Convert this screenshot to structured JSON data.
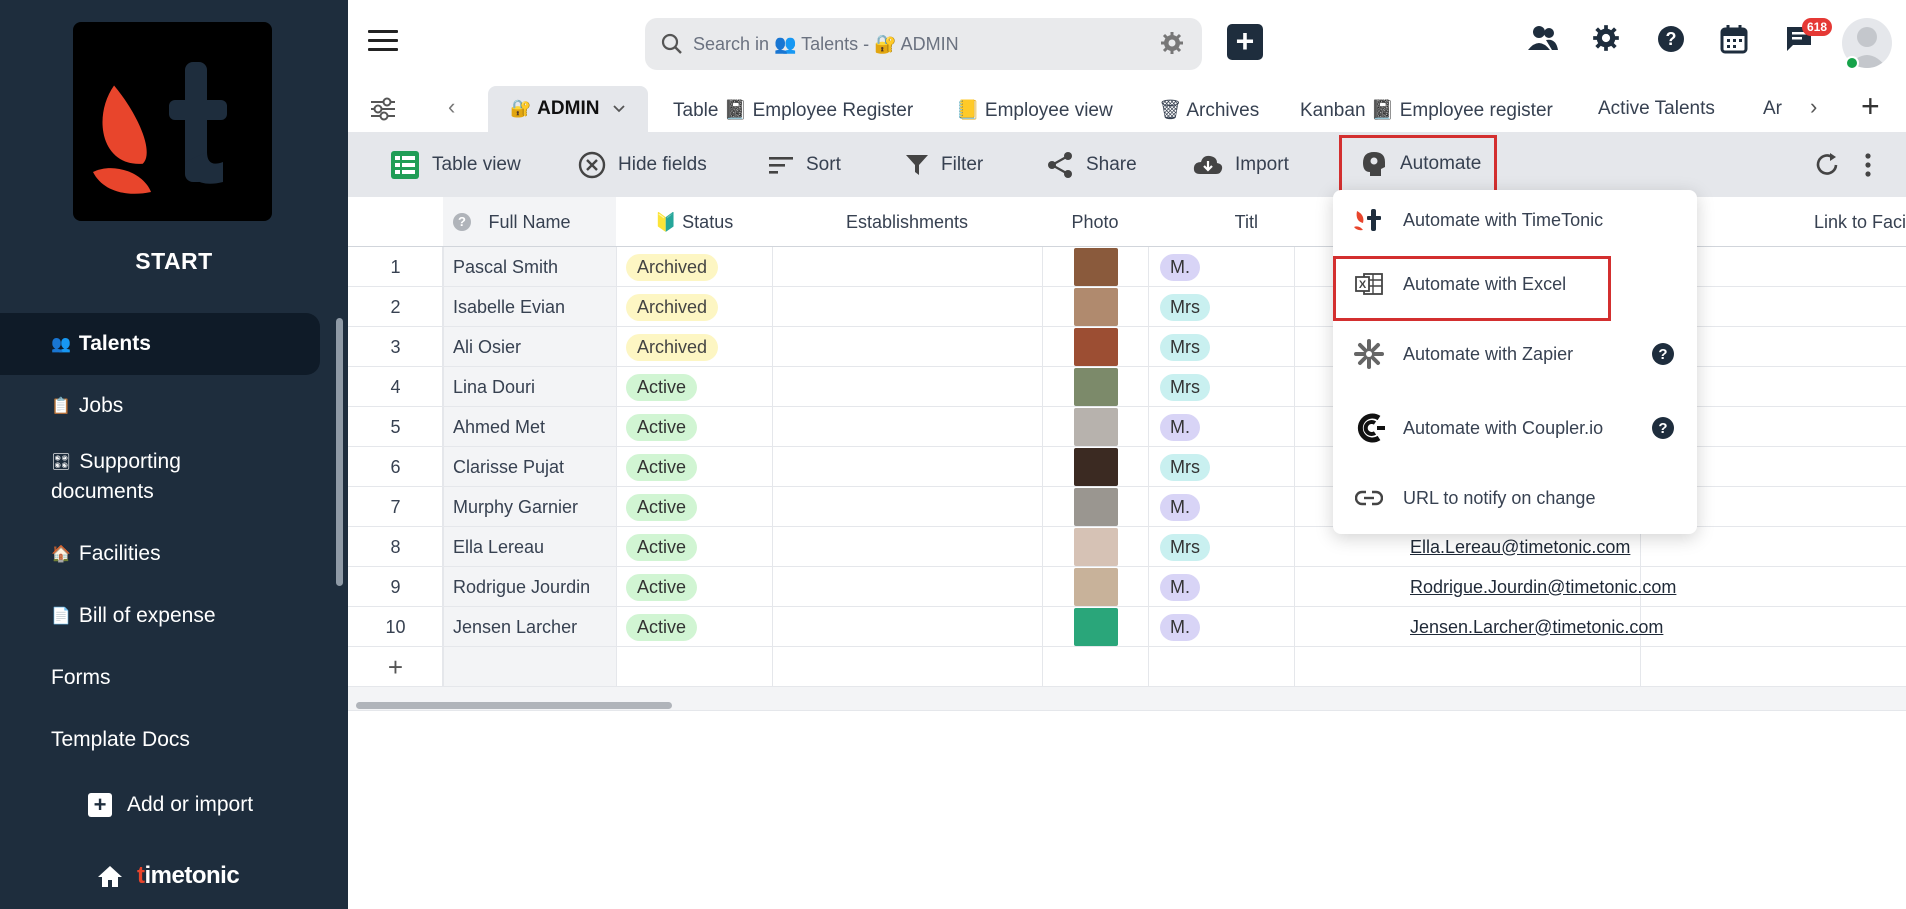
{
  "sidebar": {
    "app_name": "START",
    "items": [
      {
        "label": "Talents",
        "emoji": "👥"
      },
      {
        "label": "Jobs",
        "emoji": "📋"
      },
      {
        "label": "Supporting",
        "label2": "documents",
        "emoji": "🎛"
      },
      {
        "label": "Facilities",
        "emoji": "🏠"
      },
      {
        "label": "Bill of expense",
        "emoji": "📄"
      },
      {
        "label": "Forms"
      },
      {
        "label": "Template Docs"
      }
    ],
    "add_import": "Add or import",
    "brand": {
      "accent": "t",
      "rest": "imetonic"
    }
  },
  "topbar": {
    "search_placeholder": "Search in 👥 Talents - 🔐 ADMIN",
    "notification_count": "618"
  },
  "tabs": {
    "active": "ADMIN",
    "items": [
      "Table 📓 Employee Register",
      "📒 Employee view",
      "🗑 Archives",
      "Kanban 📓 Employee register",
      "Active Talents",
      "Ar"
    ]
  },
  "toolbar": {
    "table_view": "Table view",
    "hide_fields": "Hide fields",
    "sort": "Sort",
    "filter": "Filter",
    "share": "Share",
    "import": "Import",
    "automate": "Automate"
  },
  "table": {
    "columns": [
      "Full Name",
      "🔰 Status",
      "Establishments",
      "Photo",
      "Titl",
      "Link to Faci"
    ],
    "rows": [
      {
        "num": "1",
        "name": "Pascal Smith",
        "status": "Archived",
        "title": "M.",
        "email": ""
      },
      {
        "num": "2",
        "name": "Isabelle Evian",
        "status": "Archived",
        "title": "Mrs",
        "email": ""
      },
      {
        "num": "3",
        "name": "Ali Osier",
        "status": "Archived",
        "title": "Mrs",
        "email": ""
      },
      {
        "num": "4",
        "name": "Lina Douri",
        "status": "Active",
        "title": "Mrs",
        "email": ""
      },
      {
        "num": "5",
        "name": "Ahmed Met",
        "status": "Active",
        "title": "M.",
        "email": ""
      },
      {
        "num": "6",
        "name": "Clarisse Pujat",
        "status": "Active",
        "title": "Mrs",
        "email": ""
      },
      {
        "num": "7",
        "name": "Murphy Garnier",
        "status": "Active",
        "title": "M.",
        "email": ""
      },
      {
        "num": "8",
        "name": "Ella Lereau",
        "status": "Active",
        "title": "Mrs",
        "email": "Ella.Lereau@timetonic.com"
      },
      {
        "num": "9",
        "name": "Rodrigue Jourdin",
        "status": "Active",
        "title": "M.",
        "email": "Rodrigue.Jourdin@timetonic.com"
      },
      {
        "num": "10",
        "name": "Jensen Larcher",
        "status": "Active",
        "title": "M.",
        "email": "Jensen.Larcher@timetonic.com"
      }
    ],
    "add_row": "+"
  },
  "automate_menu": {
    "items": [
      "Automate with TimeTonic",
      "Automate with Excel",
      "Automate with Zapier",
      "Automate with Coupler.io",
      "URL to notify on change"
    ]
  },
  "colors": {
    "sidebar_bg": "#1e2d3d",
    "accent_red": "#e8452c",
    "highlight_border": "#d32f2f",
    "archived_pill": "#fdf6c3",
    "active_pill": "#d1f5d3"
  }
}
